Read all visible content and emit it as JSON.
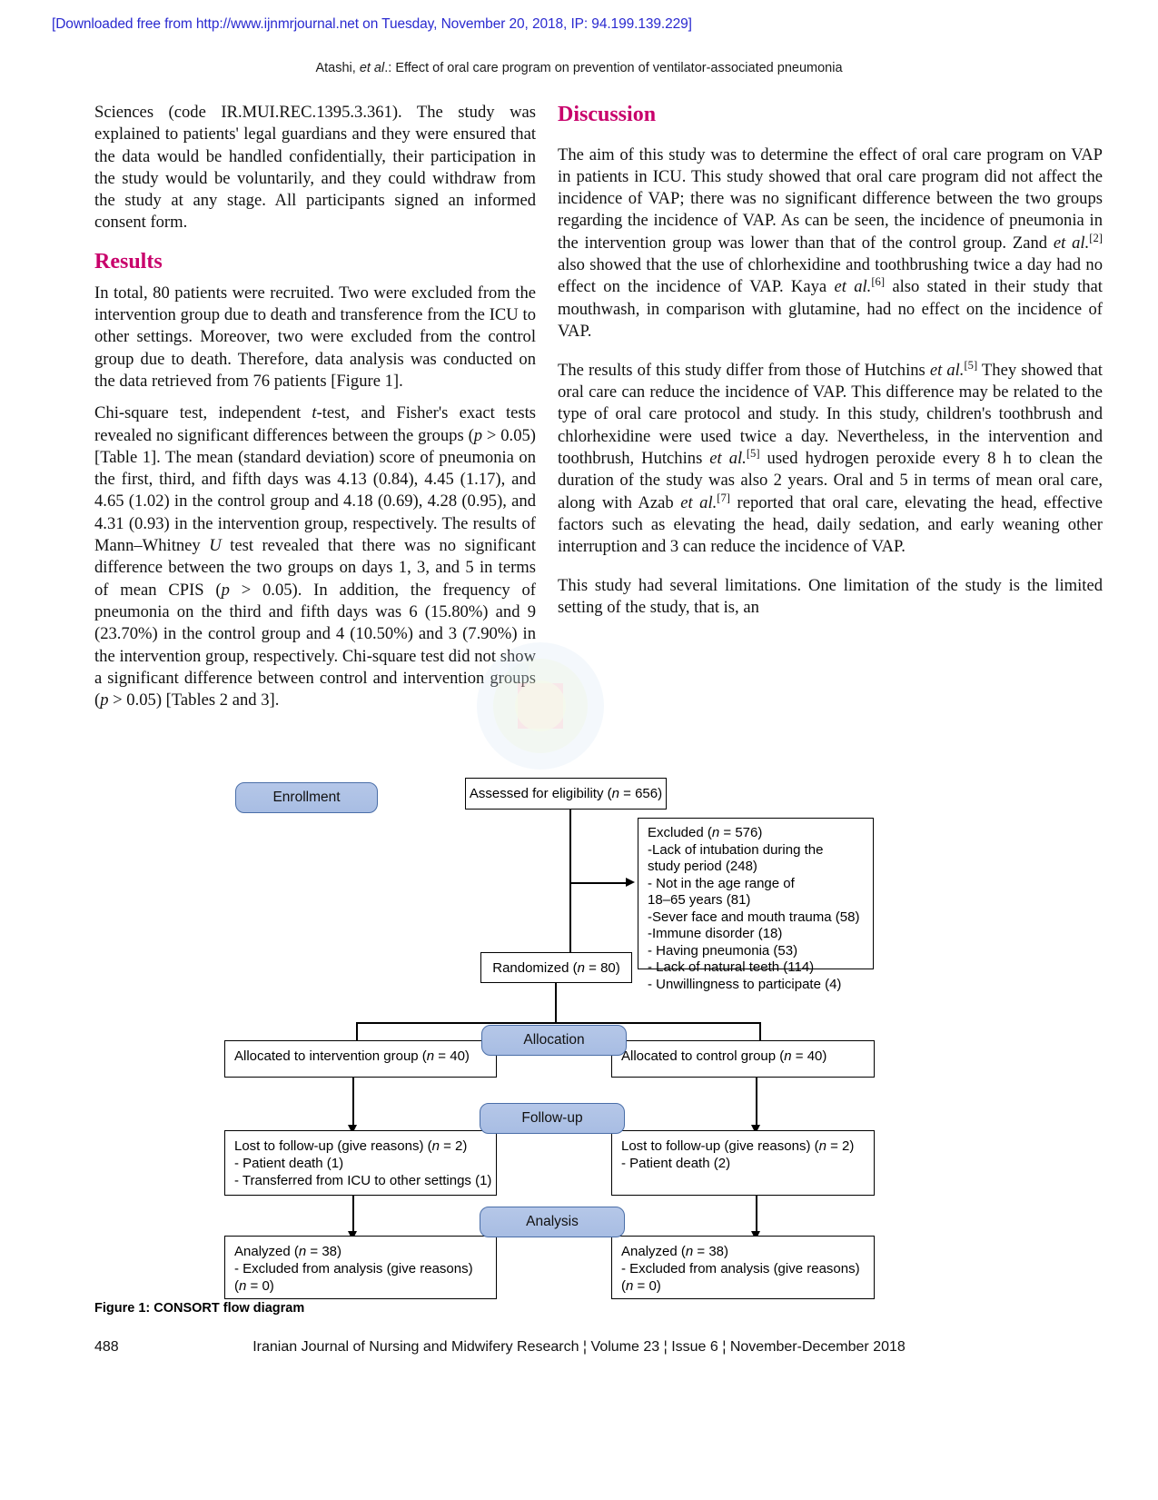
{
  "banner": {
    "text": "[Downloaded free from http://www.ijnmrjournal.net on Tuesday, November 20, 2018, IP: 94.199.139.229]",
    "color": "#2a2ad0"
  },
  "running_head": {
    "prefix": "Atashi, ",
    "italic": "et al",
    "suffix": ".: Effect of oral care program on prevention of ventilator-associated pneumonia"
  },
  "left_column": {
    "para1": "Sciences (code IR.MUI.REC.1395.3.361). The study was explained to patients' legal guardians and they were ensured that the data would be handled confidentially, their participation in the study would be voluntarily, and they could withdraw from the study at any stage. All participants signed an informed consent form.",
    "results_heading": "Results",
    "para2": "In total, 80 patients were recruited. Two were excluded from the intervention group due to death and transference from the ICU to other settings. Moreover, two were excluded from the control group due to death. Therefore, data analysis was conducted on the data retrieved from 76 patients [Figure 1].",
    "para3_a": "Chi-square test, independent ",
    "para3_t": "t",
    "para3_b": "-test, and Fisher's exact tests revealed no significant differences between the groups (",
    "para3_p1": "p",
    "para3_c": " > 0.05) [Table 1]. The mean (standard deviation) score of pneumonia on the first, third, and fifth days was 4.13 (0.84), 4.45 (1.17), and 4.65 (1.02) in the control group and 4.18 (0.69), 4.28 (0.95), and 4.31 (0.93) in the intervention group, respectively. The results of Mann–Whitney ",
    "para3_u": "U",
    "para3_d": " test revealed that there was no significant difference between the two groups on days 1, 3, and 5 in terms of mean CPIS (",
    "para3_p2": "p",
    "para3_e": " > 0.05). In addition, the frequency of pneumonia on the third and fifth days was 6 (15.80%) and 9 (23.70%) in the control group and 4 (10.50%) and 3 (7.90%) in the intervention group, respectively. Chi-square test did not show a significant difference between control and intervention groups (",
    "para3_p3": "p",
    "para3_f": " > 0.05) [Tables 2 and 3]."
  },
  "right_column": {
    "discussion_heading": "Discussion",
    "para1_a": "The aim of this study was to determine the effect of oral care program on VAP in patients in ICU. This study showed that oral care program did not affect the incidence of VAP; there was no significant difference between the two groups regarding the incidence of VAP. As can be seen, the incidence of pneumonia in the intervention group was lower than that of the control group. Zand ",
    "para1_it1": "et al.",
    "para1_sup1": "[2]",
    "para1_b": " also showed that the use of chlorhexidine and toothbrushing twice a day had no effect on the incidence of VAP. Kaya ",
    "para1_it2": "et al.",
    "para1_sup2": "[6]",
    "para1_c": " also stated in their study that mouthwash, in comparison with glutamine, had no effect on the incidence of VAP.",
    "para2_a": "The results of this study differ from those of Hutchins ",
    "para2_it1": "et al.",
    "para2_sup1": "[5]",
    "para2_b": " They showed that oral care can reduce the incidence of VAP. This difference may be related to the type of oral care protocol and study. In this study, children's toothbrush and chlorhexidine were used twice a day. Nevertheless, in the intervention and toothbrush, Hutchins ",
    "para2_it2": "et al.",
    "para2_sup2": "[5]",
    "para2_c": " used hydrogen peroxide every 8 h to clean the duration of the study was also 2 years. Oral and 5 in terms of mean oral care, along with Azab ",
    "para2_it3": "et al.",
    "para2_sup3": "[7]",
    "para2_d": " reported that oral care, elevating the head, effective factors such as elevating the head, daily sedation, and early weaning other interruption and 3 can reduce the incidence of VAP.",
    "para3": "This study had several limitations. One limitation of the study is the limited setting of the study, that is, an"
  },
  "diagram": {
    "stages": [
      {
        "label": "Enrollment"
      },
      {
        "label": "Allocation"
      },
      {
        "label": "Follow-up"
      },
      {
        "label": "Analysis"
      }
    ],
    "assessed": {
      "pre": "Assessed for eligibility (",
      "it": "n",
      "post": " = 656)"
    },
    "excluded": {
      "title_pre": "Excluded (",
      "title_it": "n",
      "title_post": " = 576)",
      "items": [
        "-Lack of intubation during the",
        " study period (248)",
        "- Not in the age range of",
        " 18–65 years (81)",
        "-Sever face and mouth trauma (58)",
        "-Immune disorder (18)",
        "- Having pneumonia (53)",
        "- Lack of natural teeth (114)",
        "- Unwillingness to participate (4)"
      ]
    },
    "randomized": {
      "pre": "Randomized (",
      "it": "n",
      "post": " = 80)"
    },
    "alloc_left": {
      "pre": "Allocated to intervention group (",
      "it": "n",
      "post": " = 40)"
    },
    "alloc_right": {
      "pre": "Allocated to control group (",
      "it": "n",
      "post": " = 40)"
    },
    "follow_left": {
      "line1_pre": "Lost to follow-up (give reasons) (",
      "line1_it": "n",
      "line1_post": " = 2)",
      "line2": "- Patient death (1)",
      "line3": "- Transferred from ICU to other settings (1)"
    },
    "follow_right": {
      "line1_pre": "Lost to follow-up (give reasons) (",
      "line1_it": "n",
      "line1_post": " = 2)",
      "line2": "- Patient death (2)"
    },
    "analysis_left": {
      "line1_pre": "Analyzed (",
      "line1_it": "n",
      "line1_post": " = 38)",
      "line2": "- Excluded from analysis (give reasons)",
      "line3_pre": "  (",
      "line3_it": "n",
      "line3_post": " = 0)"
    },
    "analysis_right": {
      "line1_pre": "Analyzed (",
      "line1_it": "n",
      "line1_post": " = 38)",
      "line2": "- Excluded from analysis (give reasons)",
      "line3_pre": "  (",
      "line3_it": "n",
      "line3_post": " = 0)"
    }
  },
  "figure_caption": "Figure 1: CONSORT flow diagram",
  "footer": {
    "page_number": "488",
    "journal_line": "Iranian Journal of Nursing and Midwifery Research ¦ Volume 23 ¦ Issue 6 ¦ November-December 2018"
  },
  "colors": {
    "heading": "#c8006b",
    "link": "#2a2ad0",
    "stage_fill": "#b0c3e6",
    "stage_border": "#4a6ea8"
  }
}
